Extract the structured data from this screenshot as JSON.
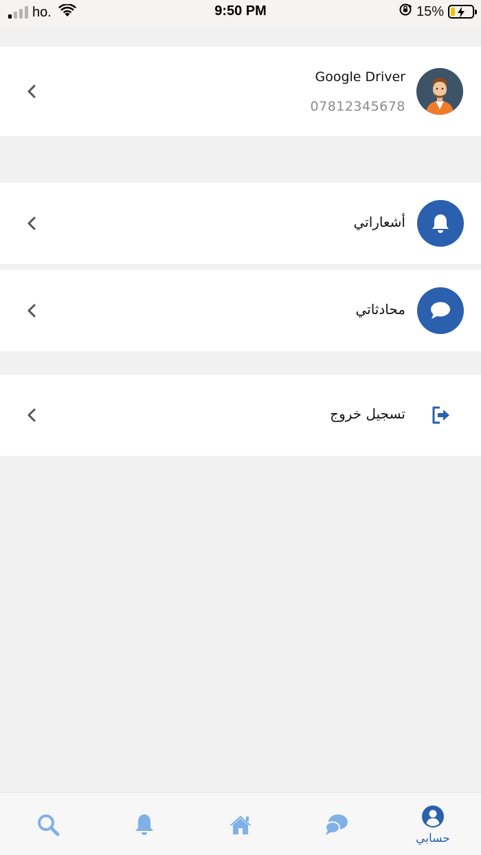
{
  "status_bar": {
    "carrier": "ho.",
    "time": "9:50 PM",
    "battery_percent": "15%",
    "battery_level": 0.15,
    "signal_bars_active": 1
  },
  "profile": {
    "name": "Google Driver",
    "phone": "07812345678",
    "avatar_icon": "person-avatar-icon"
  },
  "menu": {
    "notifications": {
      "label": "أشعاراتي",
      "icon": "bell-icon"
    },
    "chats": {
      "label": "محادثاتي",
      "icon": "chat-bubble-icon"
    },
    "logout": {
      "label": "تسجيل خروج",
      "icon": "logout-icon"
    }
  },
  "bottom_nav": {
    "items": [
      {
        "icon": "search-icon",
        "label": ""
      },
      {
        "icon": "bell-icon",
        "label": ""
      },
      {
        "icon": "home-icon",
        "label": ""
      },
      {
        "icon": "chat-icon",
        "label": ""
      },
      {
        "icon": "account-icon",
        "label": "حسابي",
        "active": true
      }
    ]
  },
  "colors": {
    "primary": "#2a60ad",
    "nav_inactive": "#7fb1e6",
    "background": "#f1f1f1",
    "surface": "#ffffff"
  }
}
